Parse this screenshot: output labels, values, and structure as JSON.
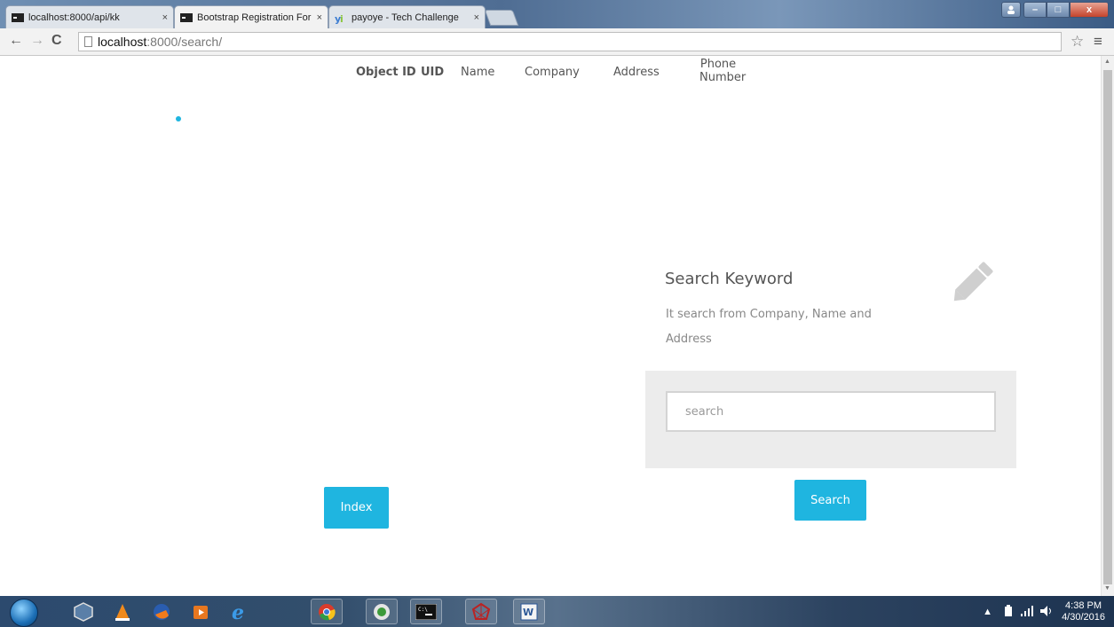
{
  "browser": {
    "tabs": [
      {
        "title": "localhost:8000/api/kk",
        "close": "×"
      },
      {
        "title": "Bootstrap Registration For",
        "close": "×"
      },
      {
        "title": "payoye - Tech Challenge",
        "close": "×"
      }
    ],
    "url_host": "localhost",
    "url_path": ":8000/search/",
    "window_buttons": {
      "minimize": "–",
      "maximize": "□",
      "close": "x"
    }
  },
  "table_headers": {
    "object_id": "Object ID",
    "uid": "UID",
    "name": "Name",
    "company": "Company",
    "address": "Address",
    "phone_line1": "Phone",
    "phone_line2": "Number"
  },
  "search_card": {
    "title": "Search Keyword",
    "description": "It search from Company, Name and Address",
    "placeholder": "search",
    "search_button": "Search"
  },
  "index_button": "Index",
  "taskbar": {
    "time": "4:38 PM",
    "date": "4/30/2016"
  },
  "colors": {
    "accent": "#1fb5e0",
    "panel": "#ececec"
  }
}
